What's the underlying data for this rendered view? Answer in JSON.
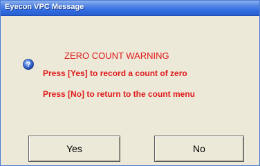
{
  "window": {
    "title": "Eyecon VPC Message"
  },
  "message": {
    "icon": "help-icon",
    "heading": "ZERO COUNT WARNING",
    "line1": "Press [Yes] to record a count of zero",
    "line2": "Press [No] to return to the count menu",
    "text_color": "#e01a1a"
  },
  "buttons": {
    "yes_label": "Yes",
    "no_label": "No"
  },
  "colors": {
    "titlebar": "#2f6ae0",
    "dialog_bg": "#ece9d8"
  }
}
